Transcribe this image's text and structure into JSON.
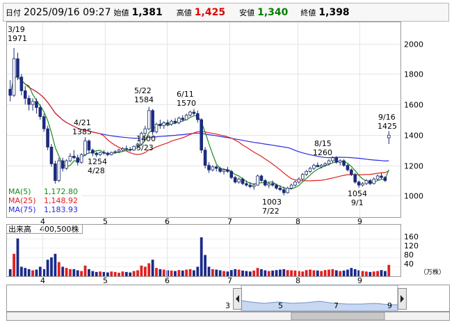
{
  "header": {
    "date_label": "日付",
    "datetime": "2025/09/16 09:27",
    "open_label": "始値",
    "open_value": "1,381",
    "high_label": "高値",
    "high_value": "1,425",
    "low_label": "安値",
    "low_value": "1,340",
    "close_label": "終値",
    "close_value": "1,398",
    "colors": {
      "high": "#e00000",
      "low": "#008000"
    }
  },
  "legend": {
    "ma5_label": "MA(5)",
    "ma5_value": "1,172.80",
    "ma25_label": "MA(25)",
    "ma25_value": "1,148.92",
    "ma75_label": "MA(75)",
    "ma75_value": "1,183.93",
    "colors": {
      "ma5": "#1a8a1a",
      "ma25": "#e02020",
      "ma75": "#2a2ae0"
    }
  },
  "volume_panel": {
    "title": "出来高",
    "scale": "400,500株",
    "unit": "（万株）",
    "y_ticks": [
      "160",
      "120",
      "80",
      "40"
    ]
  },
  "annotations": [
    {
      "date": "3/19",
      "price": "1971"
    },
    {
      "date": "4/21",
      "price": "1385"
    },
    {
      "price": "1254",
      "date": "4/28"
    },
    {
      "date": "5/22",
      "price": "1584"
    },
    {
      "price": "1400",
      "date": "5/23"
    },
    {
      "date": "6/11",
      "price": "1570"
    },
    {
      "date": "8/15",
      "price": "1260"
    },
    {
      "price": "1003",
      "date": "7/22"
    },
    {
      "price": "1054",
      "date": "9/1"
    },
    {
      "date": "9/16",
      "price": "1425"
    }
  ],
  "navigator": {
    "labels": [
      "3",
      "5",
      "7",
      "9"
    ]
  },
  "chart_data": {
    "type": "candlestick",
    "price_axis": {
      "ticks": [
        2000,
        1800,
        1600,
        1400,
        1200,
        1000
      ],
      "ylim": [
        860,
        2140
      ]
    },
    "month_ticks": [
      "4",
      "5",
      "6",
      "7",
      "8",
      "9"
    ],
    "candles": [
      [
        1700,
        1760,
        1620,
        1660
      ],
      [
        1660,
        1971,
        1650,
        1900
      ],
      [
        1900,
        1940,
        1760,
        1780
      ],
      [
        1780,
        1800,
        1660,
        1690
      ],
      [
        1690,
        1720,
        1600,
        1640
      ],
      [
        1640,
        1660,
        1560,
        1600
      ],
      [
        1600,
        1640,
        1560,
        1620
      ],
      [
        1620,
        1640,
        1540,
        1580
      ],
      [
        1580,
        1600,
        1500,
        1520
      ],
      [
        1520,
        1540,
        1420,
        1440
      ],
      [
        1440,
        1460,
        1300,
        1320
      ],
      [
        1320,
        1340,
        1190,
        1210
      ],
      [
        1210,
        1230,
        1080,
        1100
      ],
      [
        1100,
        1250,
        1090,
        1230
      ],
      [
        1230,
        1250,
        1160,
        1180
      ],
      [
        1180,
        1240,
        1170,
        1230
      ],
      [
        1230,
        1280,
        1220,
        1260
      ],
      [
        1260,
        1300,
        1240,
        1250
      ],
      [
        1250,
        1270,
        1200,
        1220
      ],
      [
        1220,
        1280,
        1210,
        1270
      ],
      [
        1270,
        1385,
        1260,
        1360
      ],
      [
        1360,
        1370,
        1280,
        1300
      ],
      [
        1300,
        1310,
        1260,
        1280
      ],
      [
        1280,
        1290,
        1254,
        1270
      ],
      [
        1270,
        1290,
        1260,
        1285
      ],
      [
        1285,
        1300,
        1270,
        1280
      ],
      [
        1280,
        1290,
        1260,
        1270
      ],
      [
        1270,
        1290,
        1265,
        1285
      ],
      [
        1285,
        1300,
        1275,
        1290
      ],
      [
        1290,
        1310,
        1280,
        1300
      ],
      [
        1300,
        1320,
        1290,
        1310
      ],
      [
        1310,
        1330,
        1300,
        1305
      ],
      [
        1305,
        1320,
        1290,
        1300
      ],
      [
        1300,
        1330,
        1295,
        1325
      ],
      [
        1325,
        1350,
        1310,
        1340
      ],
      [
        1340,
        1420,
        1330,
        1410
      ],
      [
        1410,
        1460,
        1390,
        1440
      ],
      [
        1440,
        1584,
        1430,
        1560
      ],
      [
        1560,
        1570,
        1400,
        1420
      ],
      [
        1420,
        1480,
        1410,
        1470
      ],
      [
        1470,
        1500,
        1440,
        1460
      ],
      [
        1460,
        1490,
        1440,
        1480
      ],
      [
        1480,
        1500,
        1460,
        1470
      ],
      [
        1470,
        1500,
        1460,
        1490
      ],
      [
        1490,
        1510,
        1470,
        1480
      ],
      [
        1480,
        1520,
        1470,
        1510
      ],
      [
        1510,
        1530,
        1490,
        1500
      ],
      [
        1500,
        1540,
        1495,
        1530
      ],
      [
        1530,
        1560,
        1520,
        1550
      ],
      [
        1550,
        1570,
        1530,
        1540
      ],
      [
        1540,
        1560,
        1480,
        1500
      ],
      [
        1500,
        1510,
        1280,
        1300
      ],
      [
        1300,
        1320,
        1180,
        1200
      ],
      [
        1200,
        1220,
        1150,
        1170
      ],
      [
        1170,
        1200,
        1160,
        1190
      ],
      [
        1190,
        1200,
        1160,
        1180
      ],
      [
        1180,
        1190,
        1150,
        1160
      ],
      [
        1160,
        1180,
        1140,
        1170
      ],
      [
        1170,
        1190,
        1150,
        1160
      ],
      [
        1160,
        1170,
        1110,
        1120
      ],
      [
        1120,
        1130,
        1080,
        1090
      ],
      [
        1090,
        1120,
        1080,
        1110
      ],
      [
        1110,
        1120,
        1070,
        1080
      ],
      [
        1080,
        1100,
        1060,
        1070
      ],
      [
        1070,
        1090,
        1050,
        1060
      ],
      [
        1060,
        1080,
        1040,
        1070
      ],
      [
        1070,
        1140,
        1065,
        1130
      ],
      [
        1130,
        1140,
        1090,
        1100
      ],
      [
        1100,
        1110,
        1060,
        1070
      ],
      [
        1070,
        1090,
        1050,
        1080
      ],
      [
        1080,
        1100,
        1060,
        1070
      ],
      [
        1070,
        1080,
        1040,
        1050
      ],
      [
        1050,
        1070,
        1030,
        1040
      ],
      [
        1040,
        1060,
        1003,
        1020
      ],
      [
        1020,
        1060,
        1015,
        1050
      ],
      [
        1050,
        1080,
        1040,
        1070
      ],
      [
        1070,
        1100,
        1060,
        1090
      ],
      [
        1090,
        1120,
        1080,
        1110
      ],
      [
        1110,
        1150,
        1100,
        1140
      ],
      [
        1140,
        1170,
        1130,
        1160
      ],
      [
        1160,
        1190,
        1150,
        1180
      ],
      [
        1180,
        1210,
        1170,
        1200
      ],
      [
        1200,
        1220,
        1190,
        1190
      ],
      [
        1190,
        1210,
        1180,
        1200
      ],
      [
        1200,
        1220,
        1190,
        1210
      ],
      [
        1210,
        1240,
        1200,
        1230
      ],
      [
        1230,
        1260,
        1220,
        1250
      ],
      [
        1250,
        1260,
        1210,
        1220
      ],
      [
        1220,
        1240,
        1200,
        1230
      ],
      [
        1230,
        1240,
        1190,
        1200
      ],
      [
        1200,
        1210,
        1160,
        1170
      ],
      [
        1170,
        1180,
        1130,
        1140
      ],
      [
        1140,
        1150,
        1080,
        1090
      ],
      [
        1090,
        1100,
        1054,
        1070
      ],
      [
        1070,
        1090,
        1060,
        1080
      ],
      [
        1080,
        1110,
        1070,
        1100
      ],
      [
        1100,
        1110,
        1070,
        1080
      ],
      [
        1080,
        1120,
        1075,
        1110
      ],
      [
        1110,
        1140,
        1100,
        1130
      ],
      [
        1130,
        1150,
        1110,
        1120
      ],
      [
        1120,
        1130,
        1090,
        1100
      ],
      [
        1381,
        1425,
        1340,
        1398
      ]
    ],
    "volume_max": 180,
    "volumes": [
      30,
      95,
      160,
      40,
      35,
      30,
      25,
      28,
      40,
      30,
      70,
      80,
      95,
      60,
      40,
      35,
      30,
      30,
      25,
      22,
      45,
      30,
      22,
      18,
      20,
      18,
      16,
      20,
      18,
      15,
      20,
      18,
      16,
      22,
      25,
      45,
      40,
      55,
      70,
      35,
      30,
      28,
      25,
      24,
      22,
      26,
      24,
      28,
      30,
      25,
      40,
      165,
      90,
      40,
      30,
      28,
      25,
      22,
      20,
      26,
      30,
      28,
      24,
      22,
      20,
      24,
      35,
      30,
      25,
      22,
      24,
      26,
      28,
      30,
      26,
      25,
      24,
      22,
      20,
      26,
      28,
      25,
      24,
      22,
      26,
      28,
      30,
      25,
      22,
      24,
      28,
      35,
      30,
      25,
      22,
      20,
      18,
      20,
      22,
      26,
      22,
      48
    ]
  }
}
